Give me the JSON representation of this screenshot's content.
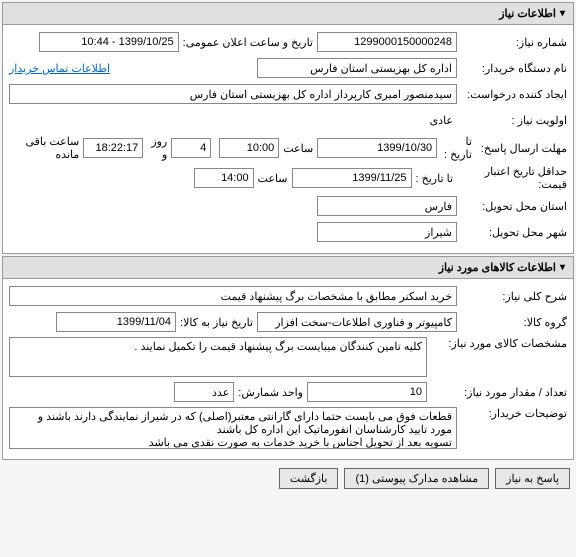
{
  "section1": {
    "title": "اطلاعات نیاز",
    "need_number_label": "شماره نیاز:",
    "need_number": "1299000150000248",
    "public_datetime_label": "تاریخ و ساعت اعلان عمومی:",
    "public_datetime": "1399/10/25 - 10:44",
    "buyer_org_label": "نام دستگاه خریدار:",
    "buyer_org": "اداره کل بهزیستی استان فارس",
    "buyer_contact_link": "اطلاعات تماس خریدار",
    "creator_label": "ایجاد کننده درخواست:",
    "creator": "سیدمنصور امیری کارپرداز اداره کل بهزیستی استان فارس",
    "priority_label": "اولویت نیاز :",
    "priority": "عادی",
    "deadline_label": "مهلت ارسال پاسخ:",
    "deadline_to_label": "تا تاریخ :",
    "deadline_date": "1399/10/30",
    "time_label": "ساعت",
    "deadline_time": "10:00",
    "days_left": "4",
    "days_label": "روز و",
    "hours_left": "18:22:17",
    "remaining_label": "ساعت باقی مانده",
    "min_validity_label": "حداقل تاریخ اعتبار قیمت:",
    "min_validity_to_label": "تا تاریخ :",
    "min_validity_date": "1399/11/25",
    "min_validity_time": "14:00",
    "province_label": "استان محل تحویل:",
    "province": "فارس",
    "city_label": "شهر محل تحویل:",
    "city": "شیراز"
  },
  "section2": {
    "title": "اطلاعات کالاهای مورد نیاز",
    "general_desc_label": "شرح کلی نیاز:",
    "general_desc": "خرید اسکنر مطابق با مشخصات برگ پیشنهاد قیمت",
    "goods_group_label": "گروه کالا:",
    "goods_group": "کامپیوتر و فناوری اطلاعات-سخت افزار",
    "need_date_label": "تاریخ نیاز به کالا:",
    "need_date": "1399/11/04",
    "goods_spec_label": "مشخصات کالای مورد نیاز:",
    "goods_spec": "کلیه تامین کنندگان میبایست برگ پیشنهاد قیمت را تکمیل نمایند .",
    "quantity_label": "تعداد / مقدار مورد نیاز:",
    "quantity": "10",
    "unit_label": "واحد شمارش:",
    "unit": "عدد",
    "buyer_notes_label": "توضیحات خریدار:",
    "buyer_notes": "قطعات فوق می بایست حتما دارای گارانتی معتبر(اصلی) که در شیراز نمایندگی دارند باشند و مورد تایید کارشناسان انفورماتیک این اداره کل باشند\nتسویه بعد از تحویل اجناس با خرید خدمات به صورت نقدی می باشد"
  },
  "buttons": {
    "respond": "پاسخ به نیاز",
    "attachments": "مشاهده مدارک پیوستی (1)",
    "back": "بازگشت"
  }
}
